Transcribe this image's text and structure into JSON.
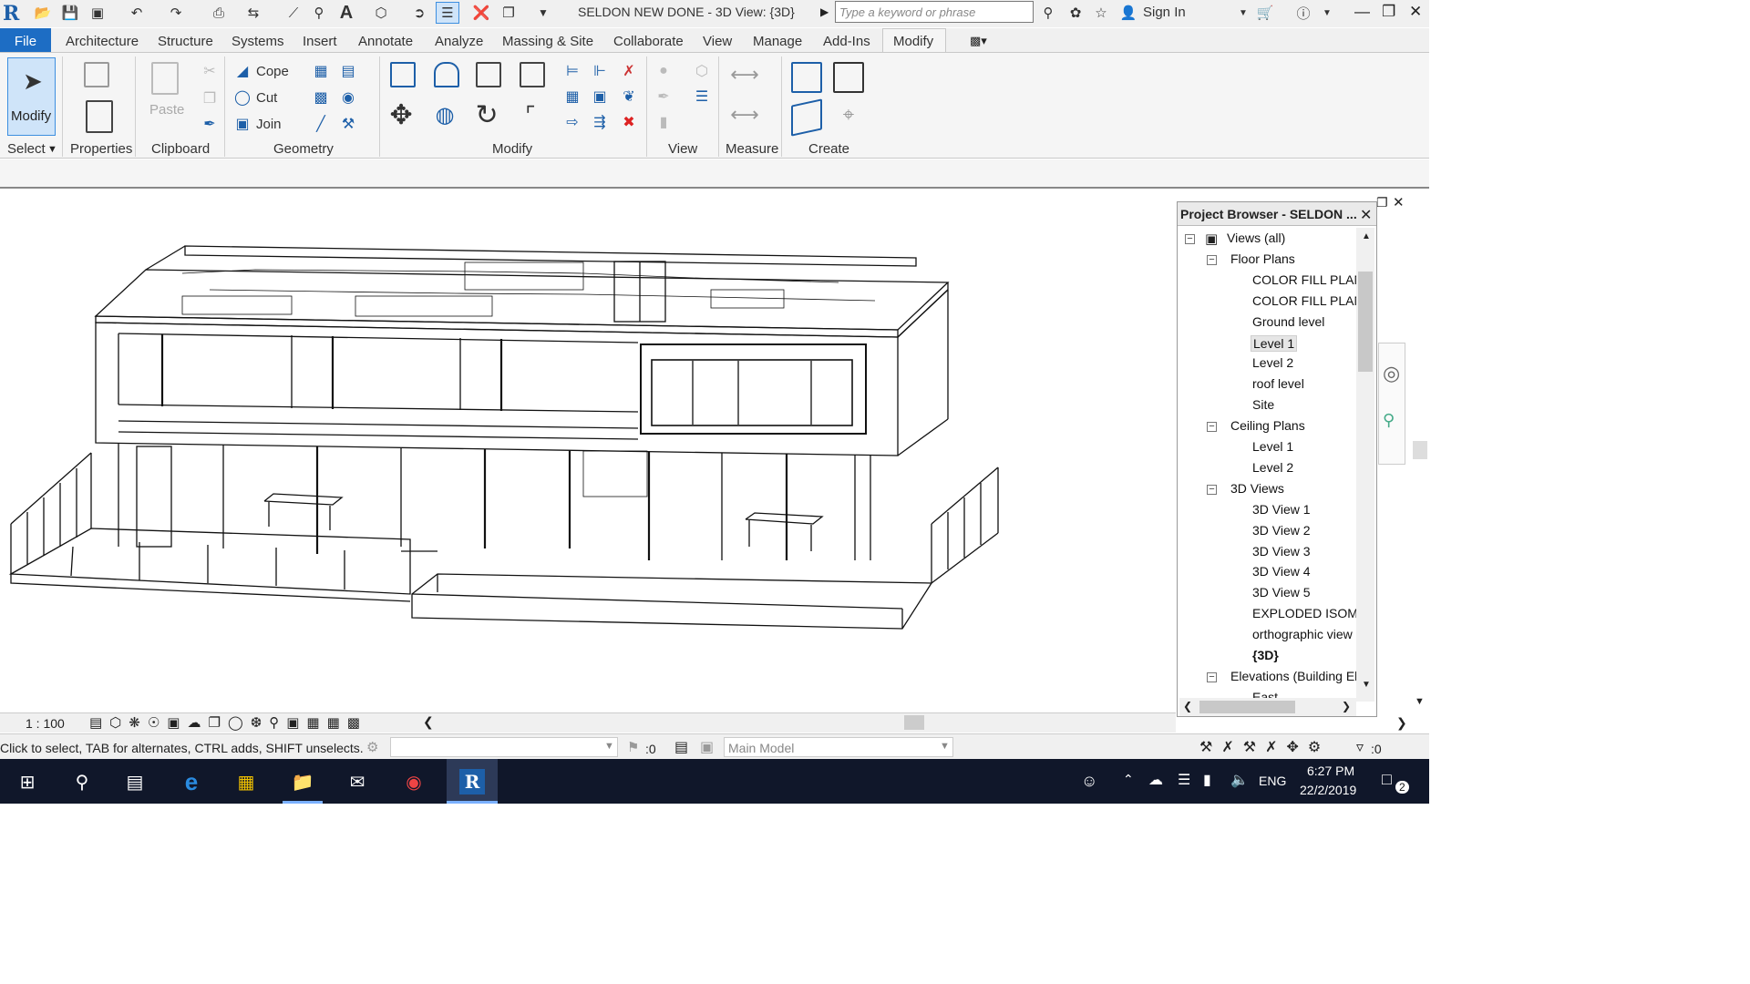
{
  "titlebar": {
    "title": "SELDON NEW DONE - 3D View: {3D}",
    "search_placeholder": "Type a keyword or phrase",
    "sign_in": "Sign In"
  },
  "menu": {
    "file": "File",
    "tabs": [
      "Architecture",
      "Structure",
      "Systems",
      "Insert",
      "Annotate",
      "Analyze",
      "Massing & Site",
      "Collaborate",
      "View",
      "Manage",
      "Add-Ins",
      "Modify"
    ]
  },
  "ribbon": {
    "modify_label": "Modify",
    "select_label": "Select",
    "properties_label": "Properties",
    "paste_label": "Paste",
    "clipboard_label": "Clipboard",
    "cope_label": "Cope",
    "cut_label": "Cut",
    "join_label": "Join",
    "geometry_label": "Geometry",
    "modify_panel_label": "Modify",
    "view_label": "View",
    "measure_label": "Measure",
    "create_label": "Create"
  },
  "project_browser": {
    "title": "Project Browser - SELDON ...",
    "items": [
      {
        "label": "Views (all)",
        "level": 0,
        "toggle": "−"
      },
      {
        "label": "Floor Plans",
        "level": 1,
        "toggle": "−"
      },
      {
        "label": "COLOR FILL PLAN",
        "level": 2
      },
      {
        "label": "COLOR FILL PLAN",
        "level": 2
      },
      {
        "label": "Ground level",
        "level": 2
      },
      {
        "label": "Level 1",
        "level": 2,
        "selected": true
      },
      {
        "label": "Level 2",
        "level": 2
      },
      {
        "label": "roof level",
        "level": 2
      },
      {
        "label": "Site",
        "level": 2
      },
      {
        "label": "Ceiling Plans",
        "level": 1,
        "toggle": "−"
      },
      {
        "label": "Level 1",
        "level": 2
      },
      {
        "label": "Level 2",
        "level": 2
      },
      {
        "label": "3D Views",
        "level": 1,
        "toggle": "−"
      },
      {
        "label": "3D View 1",
        "level": 2
      },
      {
        "label": "3D View 2",
        "level": 2
      },
      {
        "label": "3D View 3",
        "level": 2
      },
      {
        "label": "3D View 4",
        "level": 2
      },
      {
        "label": "3D View 5",
        "level": 2
      },
      {
        "label": "EXPLODED ISOMI",
        "level": 2
      },
      {
        "label": "orthographic view",
        "level": 2
      },
      {
        "label": "{3D}",
        "level": 2,
        "bold": true
      },
      {
        "label": "Elevations (Building El",
        "level": 1,
        "toggle": "−"
      },
      {
        "label": "East",
        "level": 2
      }
    ]
  },
  "viewbar": {
    "scale": "1 : 100"
  },
  "status": {
    "message": "Click to select, TAB for alternates, CTRL adds, SHIFT unselects.",
    "count": ":0",
    "model": "Main Model",
    "filter_count": ":0"
  },
  "taskbar": {
    "lang": "ENG",
    "time": "6:27 PM",
    "date": "22/2/2019",
    "notifications": "2"
  }
}
